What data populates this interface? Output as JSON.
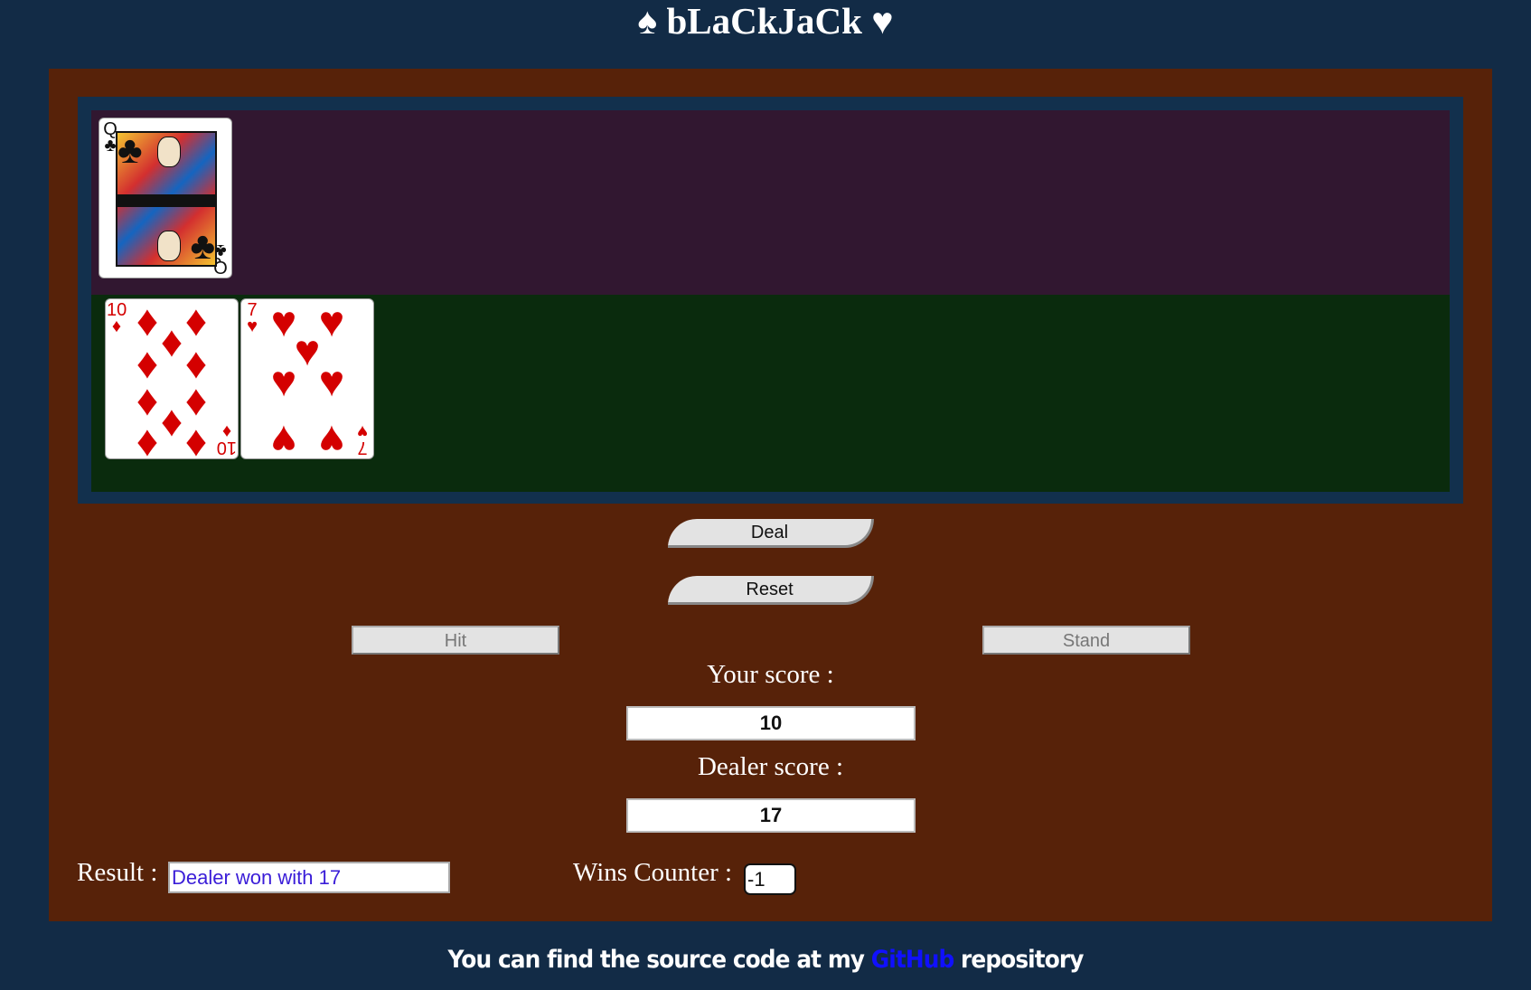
{
  "title": "♠ bLaCkJaCk ♥",
  "dealer_cards": [
    {
      "rank": "Q",
      "suit": "♣",
      "color": "#111111",
      "face": true
    }
  ],
  "player_cards": [
    {
      "rank": "10",
      "suit": "♦",
      "color": "#d40000",
      "face": false
    },
    {
      "rank": "7",
      "suit": "♥",
      "color": "#d40000",
      "face": false
    }
  ],
  "buttons": {
    "deal": "Deal",
    "reset": "Reset",
    "hit": "Hit",
    "stand": "Stand"
  },
  "scores": {
    "your_label": "Your score :",
    "your_value": "10",
    "dealer_label": "Dealer score :",
    "dealer_value": "17"
  },
  "result": {
    "label": "Result :",
    "value": "Dealer won with 17"
  },
  "wins": {
    "label": "Wins Counter :",
    "value": "-1"
  },
  "footer": {
    "before": "You can find the source code at my",
    "link": "GitHub",
    "after": "repository"
  },
  "colors": {
    "background": "#122b46",
    "table": "#572209",
    "dealer_zone": "#311730",
    "player_zone": "#0a2b0d",
    "result_text": "#3a1dd8",
    "link": "#1010ff"
  }
}
